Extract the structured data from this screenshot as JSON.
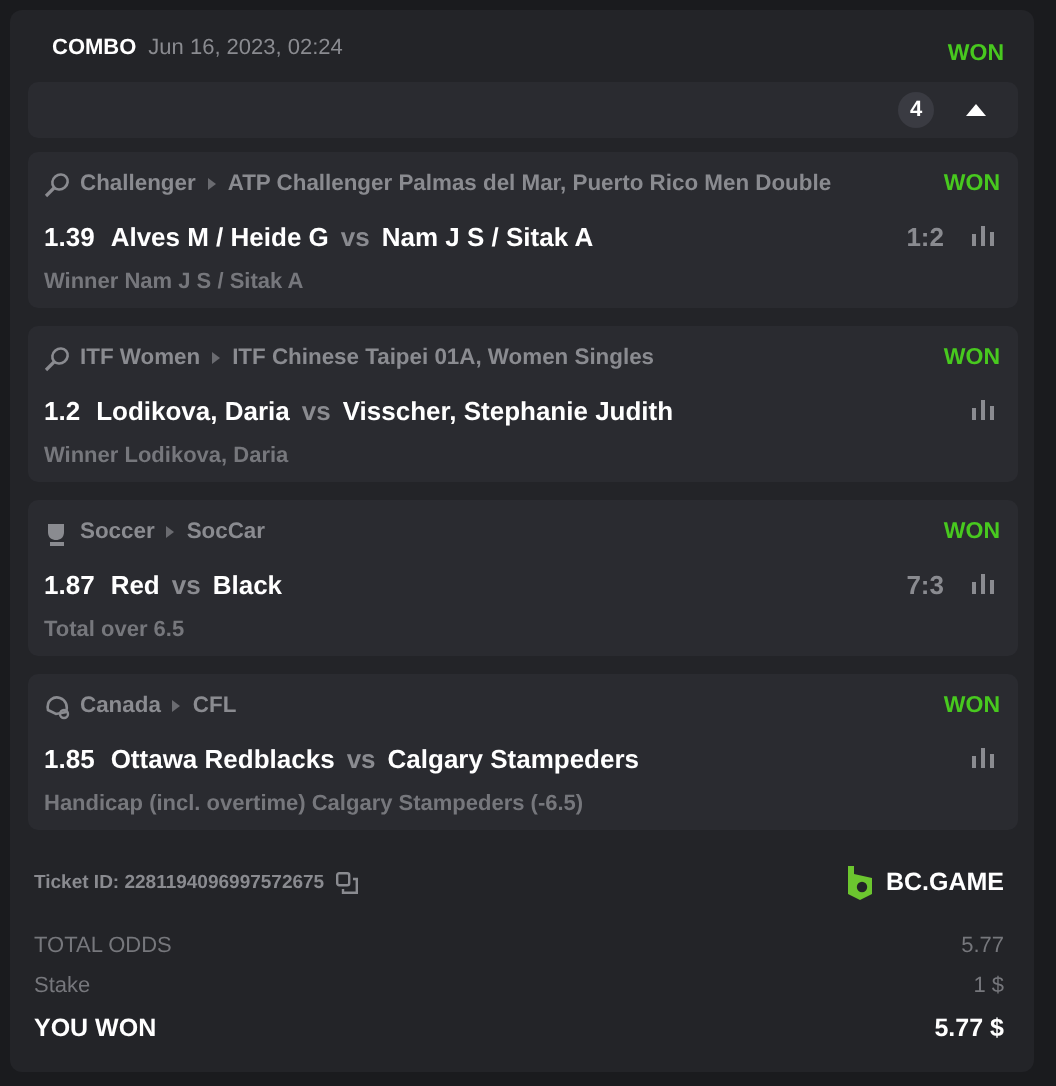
{
  "bet": {
    "type": "COMBO",
    "date": "Jun 16, 2023, 02:24",
    "status": "WON"
  },
  "legs_bar": {
    "count": "4",
    "expanded": true
  },
  "legs": [
    {
      "kind": "tennis",
      "sport": "Challenger",
      "league": "ATP Challenger Palmas del Mar, Puerto Rico Men Double",
      "status": "WON",
      "odds": "1.39",
      "home": "Alves M / Heide G",
      "vs": "vs",
      "away": "Nam J S / Sitak A",
      "score": "1:2",
      "market": "Winner Nam J S / Sitak A"
    },
    {
      "kind": "tennis",
      "sport": "ITF Women",
      "league": "ITF Chinese Taipei 01A, Women Singles",
      "status": "WON",
      "odds": "1.2",
      "home": "Lodikova, Daria",
      "vs": "vs",
      "away": "Visscher, Stephanie Judith",
      "market": "Winner Lodikova, Daria"
    },
    {
      "kind": "soccer",
      "sport": "Soccer",
      "league": "SocCar",
      "status": "WON",
      "odds": "1.87",
      "home": "Red",
      "vs": "vs",
      "away": "Black",
      "score": "7:3",
      "market": "Total over 6.5"
    },
    {
      "kind": "football",
      "sport": "Canada",
      "league": "CFL",
      "status": "WON",
      "odds": "1.85",
      "home": "Ottawa Redblacks",
      "vs": "vs",
      "away": "Calgary Stampeders",
      "market": "Handicap (incl. overtime) Calgary Stampeders (-6.5)"
    }
  ],
  "ticket": {
    "label": "Ticket ID:",
    "id": "2281194096997572675"
  },
  "brand": "BC.GAME",
  "summary": [
    {
      "kind": "muted",
      "label": "TOTAL ODDS",
      "value": "5.77"
    },
    {
      "kind": "muted",
      "label": "Stake",
      "value": "1 $"
    },
    {
      "kind": "total",
      "label": "YOU WON",
      "value": "5.77 $"
    }
  ]
}
